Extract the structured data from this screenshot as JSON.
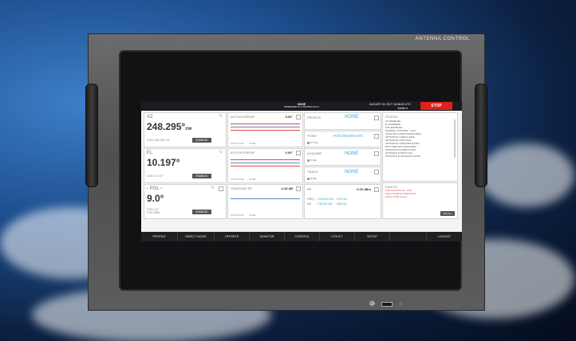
{
  "rack": {
    "label": "ANTENNA CONTROL"
  },
  "topbar": {
    "mode_title": "NONE",
    "mode_subtitle": "WORKMODE TO | CONTROL ACU H",
    "datetime": "AUGUST 15, 2017 16:36:53 UTC",
    "user": "Admin ▾",
    "stop_label": "STOP"
  },
  "az": {
    "label": "AZ",
    "value": "248.295°",
    "suffix": "cw",
    "cmd": "CMD 248.295° cw",
    "button": "ENABLED"
  },
  "el": {
    "label": "EL",
    "value": "10.197°",
    "cmd": "CMD 10.197°",
    "button": "ENABLED"
  },
  "pol": {
    "label": "‹ POL ›",
    "value": "9.0°",
    "cmd": "CMD 9.0°",
    "cmd2": "POS 0855",
    "button": "ENABLED"
  },
  "az_pos_error": {
    "label": "AZ POS ERROR",
    "value": "0.00°",
    "win_label": "WINDOW SIZE",
    "win_value": "30 SEC"
  },
  "el_pos_error": {
    "label": "EL POS ERROR",
    "value": "0.00°",
    "win_label": "WINDOW SIZE",
    "win_value": "30 SEC"
  },
  "tracking_rf": {
    "label": "TRACKING RF",
    "value": "-0.36 dB",
    "win_label": "WINDOW SIZE",
    "win_value": "30 SEC"
  },
  "profile": {
    "label": "PROFILE",
    "value": "NONE"
  },
  "point": {
    "label": "POINT",
    "value": "POS DESIGNATE",
    "state": "ACTIVE"
  },
  "acquire": {
    "label": "ACQUIRE",
    "value": "NONE",
    "state": "NONE"
  },
  "track": {
    "label": "TRACK",
    "value": "NONE",
    "state": "NONE"
  },
  "rf": {
    "label": "RF",
    "value": "0.00 dBm",
    "freq_label": "FREQ",
    "freq": "0.000000 GHz",
    "pol_label": "POL",
    "pol": "N/A",
    "bw_label": "BW",
    "bw": "1.000000 kHz",
    "sun_label": "SUN",
    "sun": "N/A"
  },
  "status": {
    "title": "STATUS",
    "items": [
      "AZ ENABLED",
      "EL ENABLED",
      "POL ENABLED",
      "NORMAL CONTROL - ACU",
      "INTELSAT COEFFS AVAILABLE",
      "OPTRACK1 COEFS AVAIL",
      "OPTRACK1 DATA OLD",
      "OPTRACK1 24HOURS GOOD",
      "NTP TIME NOT AVAILABLE",
      "OPTRACK D COEFS AVAIL",
      "OPTRACK D DATA OLD",
      "OPTRACK D 24HOURS GOOD"
    ]
  },
  "faults": {
    "title": "FAULTS",
    "items": [
      "SIMULATION ON - ACU",
      "FPGA CONFIG MISMATCH",
      "FPGA TYPE FAULT"
    ],
    "ack_label": "ACK ALL"
  },
  "nav": {
    "items": [
      "PROFILE",
      "DIRECT MODE",
      "OFFSETS",
      "MONITOR",
      "CONTROL",
      "UTILITY",
      "SETUP",
      "LOGOUT"
    ]
  },
  "colors": {
    "stop": "#e0201c",
    "accent": "#35a9d8",
    "fault": "#e04848",
    "ok": "#5cbb3a"
  }
}
